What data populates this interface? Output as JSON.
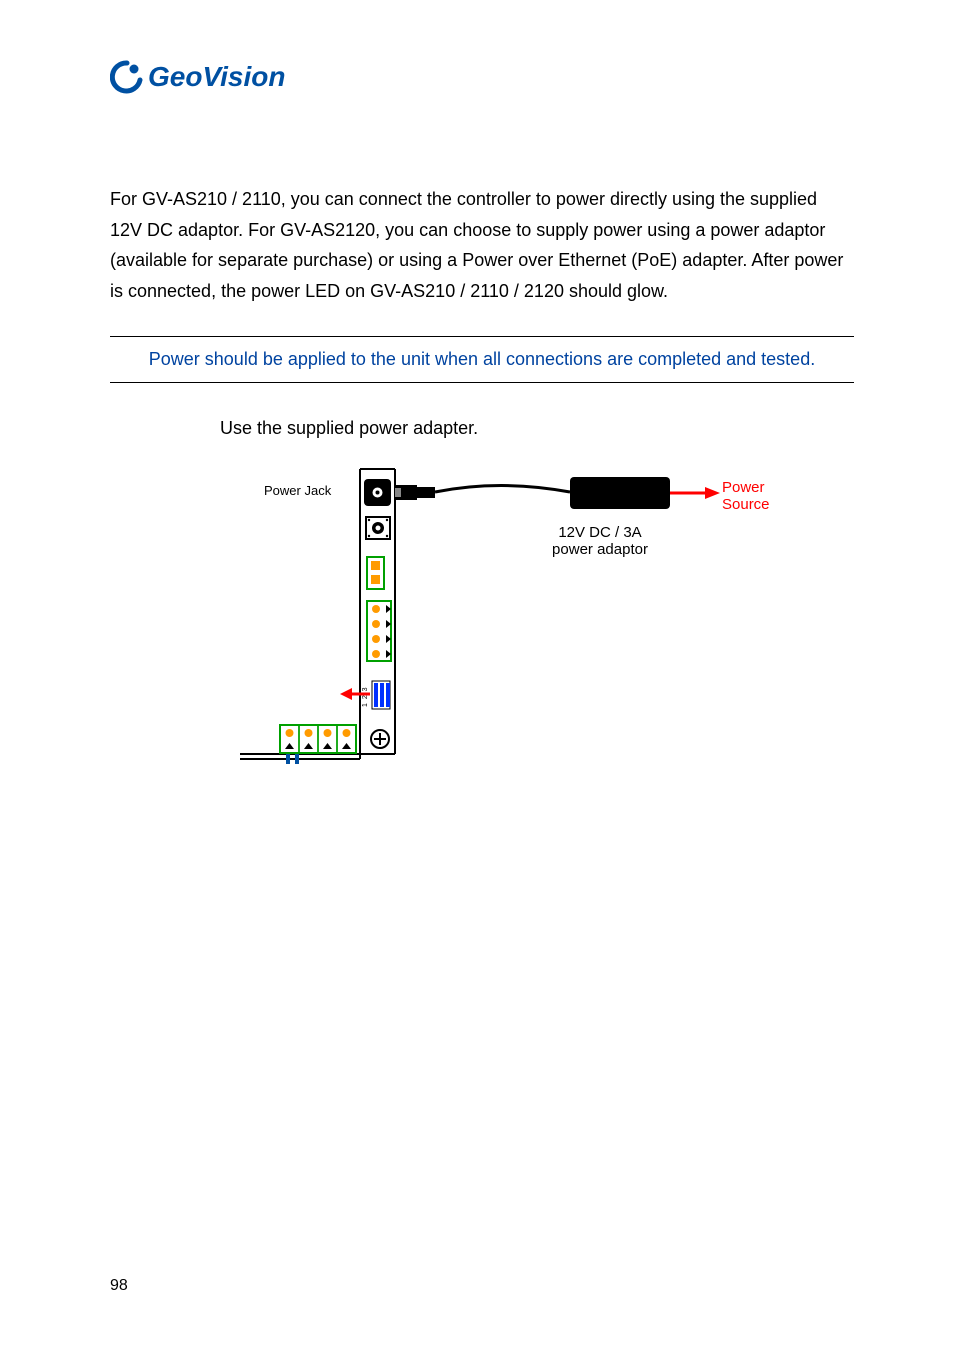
{
  "logo": {
    "brand": "GeoVision"
  },
  "paragraph": {
    "line1": "For GV-AS210 / 2110, you can connect the controller to power directly using the supplied",
    "line2": "12V DC adaptor. For GV-AS2120, you can choose to supply power using a power adaptor",
    "line3": "(available for separate purchase) or using a Power over Ethernet (PoE) adapter. After power",
    "line4": "is connected, the power LED on GV-AS210 / 2110 / 2120 should glow."
  },
  "note": "Power should be applied to the unit when all connections are completed and tested.",
  "instruction": "Use the supplied power adapter.",
  "diagram": {
    "power_jack": "Power Jack",
    "adaptor_label_line1": "12V DC / 3A",
    "adaptor_label_line2": "power adaptor",
    "power_source_line1": "Power",
    "power_source_line2": "Source",
    "dip_labels": "1 2 3"
  },
  "page_number": "98"
}
